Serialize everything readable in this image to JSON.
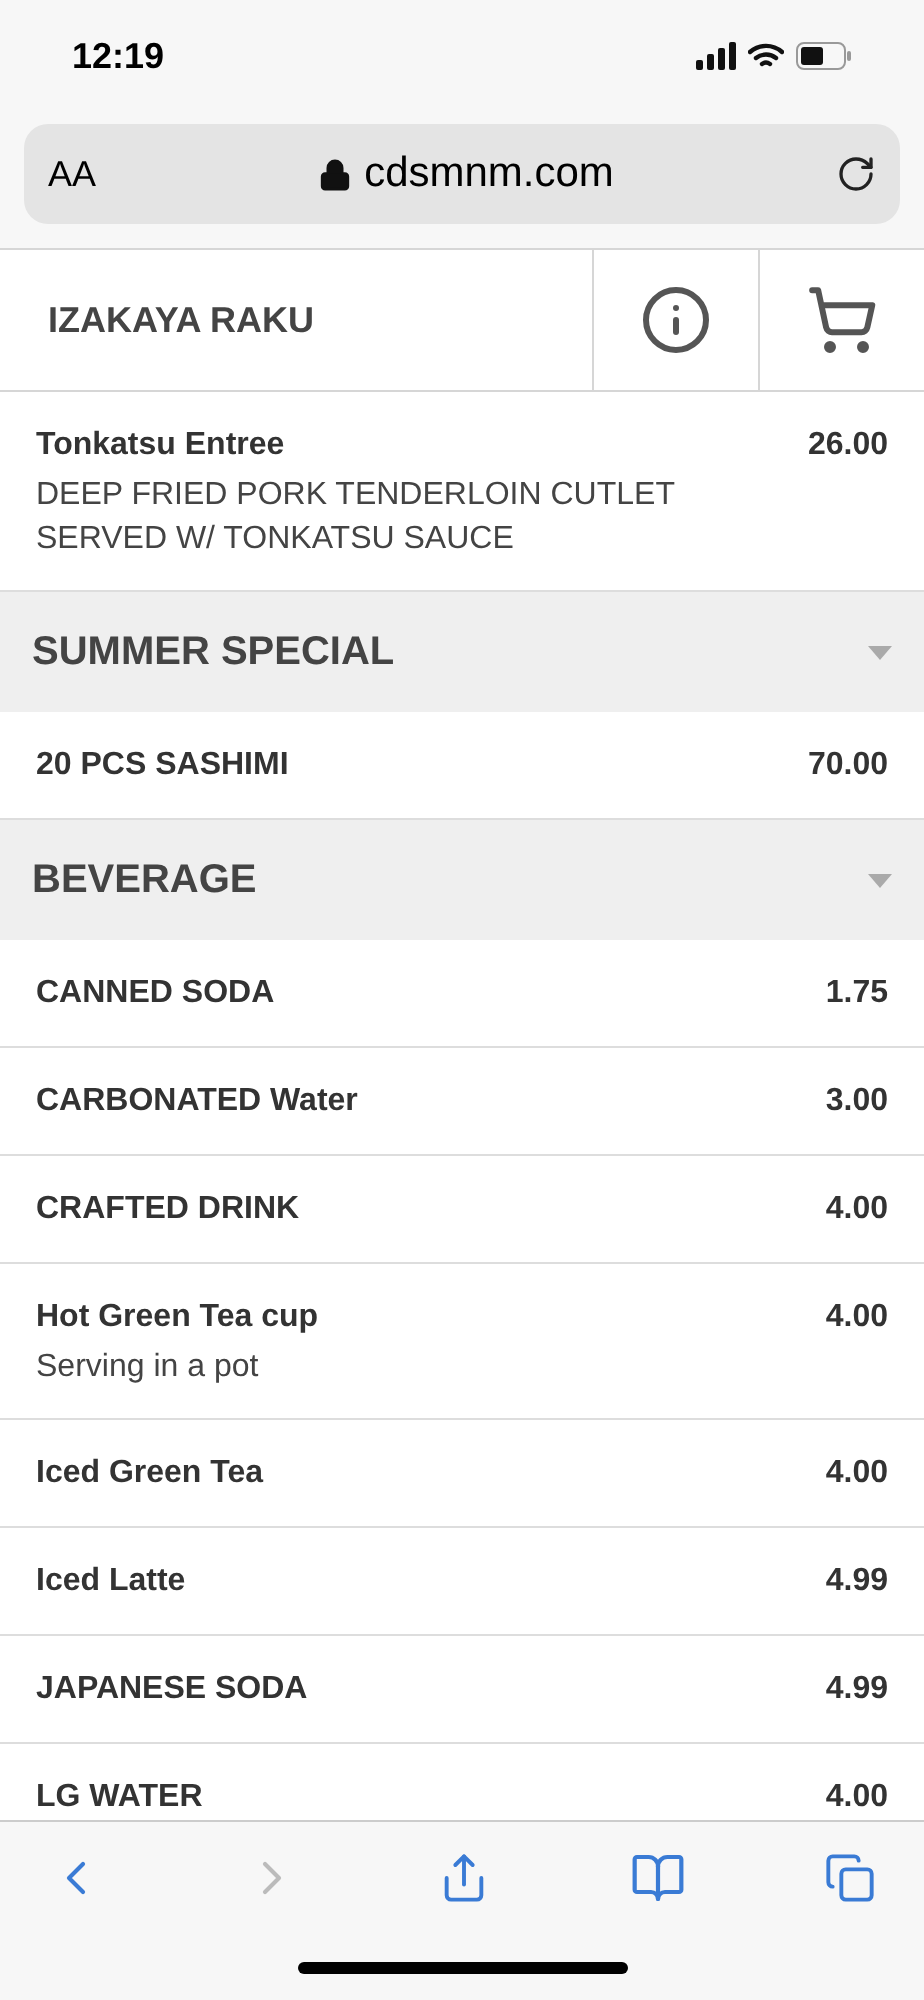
{
  "status_bar": {
    "time": "12:19"
  },
  "address_bar": {
    "text_size": "AA",
    "url": "cdsmnm.com"
  },
  "header": {
    "title": "IZAKAYA RAKU"
  },
  "menu": [
    {
      "kind": "item",
      "name": "Tonkatsu Entree",
      "price": "26.00",
      "description": "DEEP FRIED PORK TENDERLOIN CUTLET SERVED W/ TONKATSU SAUCE"
    },
    {
      "kind": "section",
      "name": "SUMMER SPECIAL"
    },
    {
      "kind": "item",
      "name": "20 PCS SASHIMI",
      "price": "70.00"
    },
    {
      "kind": "section",
      "name": "BEVERAGE"
    },
    {
      "kind": "item",
      "name": "CANNED SODA",
      "price": "1.75"
    },
    {
      "kind": "item",
      "name": "CARBONATED Water",
      "price": "3.00"
    },
    {
      "kind": "item",
      "name": "CRAFTED DRINK",
      "price": "4.00"
    },
    {
      "kind": "item",
      "name": "Hot Green Tea cup",
      "price": "4.00",
      "description": "Serving in a pot"
    },
    {
      "kind": "item",
      "name": "Iced Green Tea",
      "price": "4.00"
    },
    {
      "kind": "item",
      "name": "Iced Latte",
      "price": "4.99"
    },
    {
      "kind": "item",
      "name": "JAPANESE SODA",
      "price": "4.99"
    },
    {
      "kind": "item",
      "name": "LG WATER",
      "price": "4.00"
    }
  ]
}
